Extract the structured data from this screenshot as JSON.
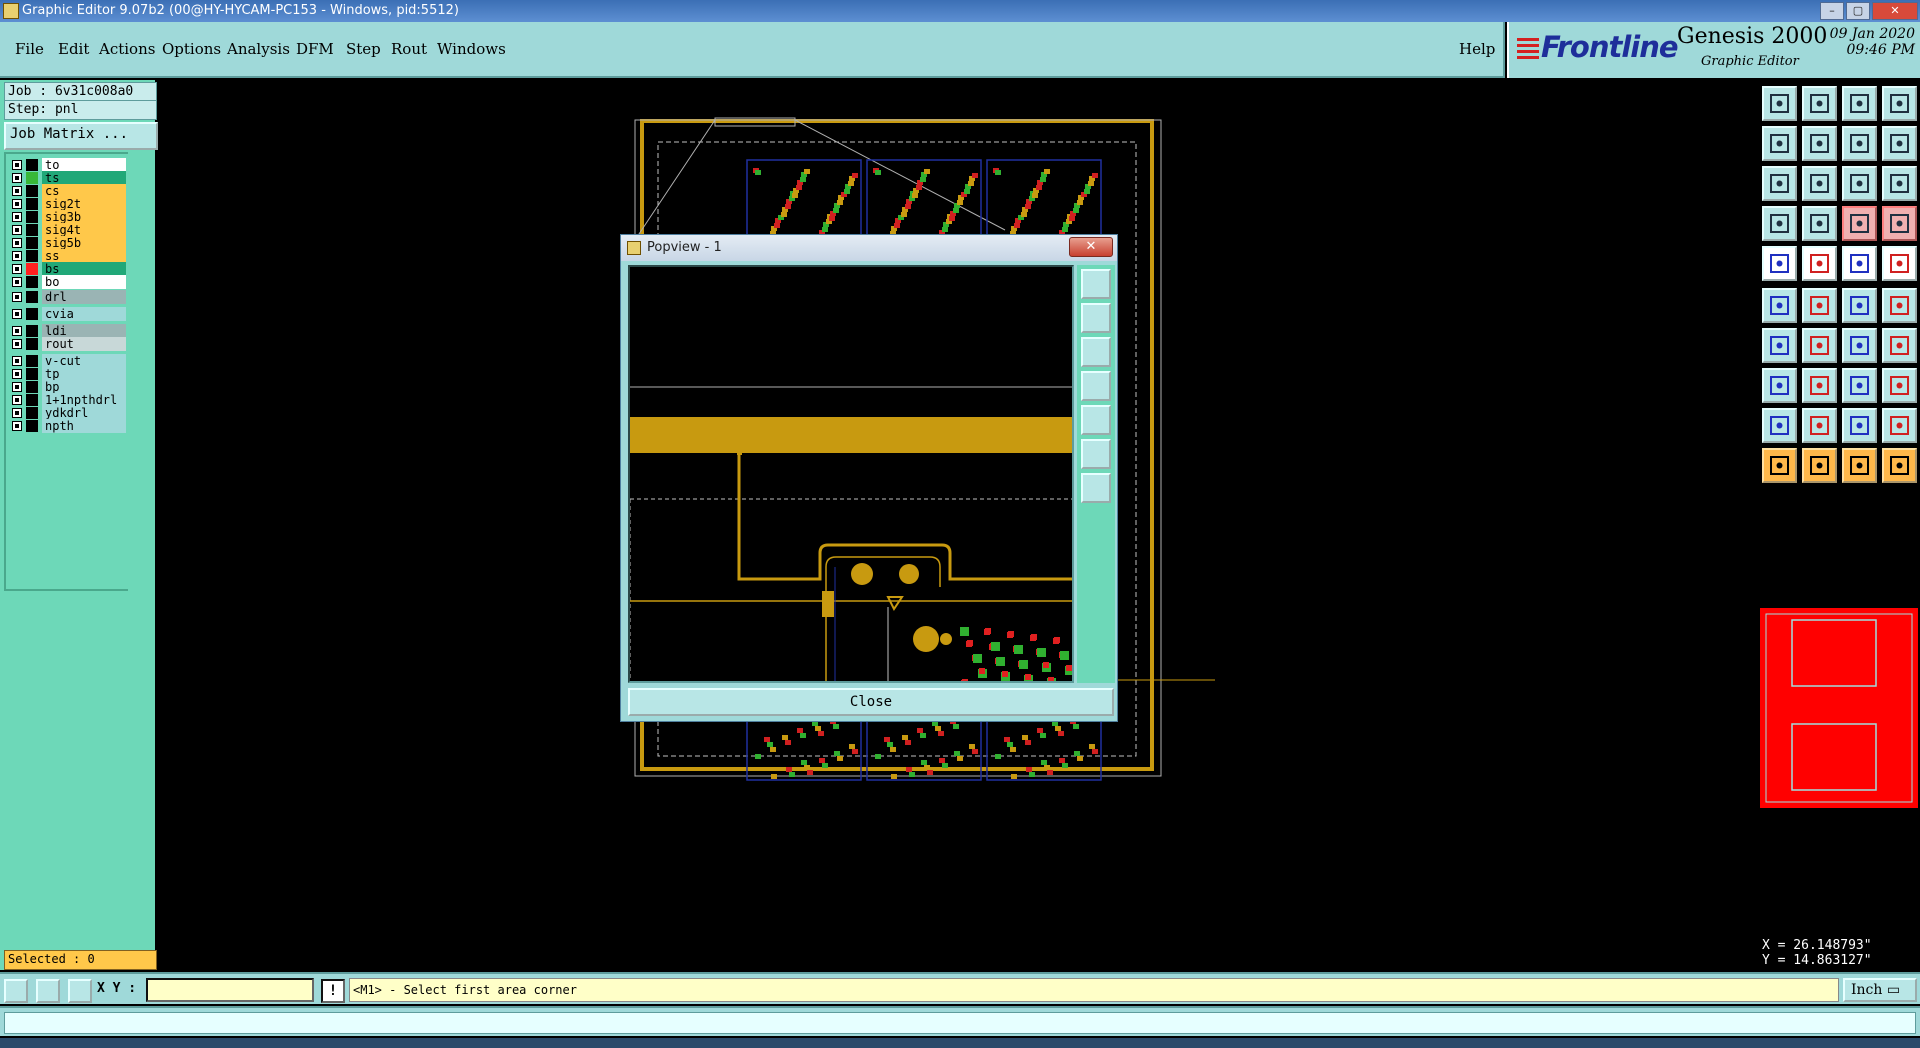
{
  "window": {
    "title": "Graphic Editor 9.07b2 (00@HY-HYCAM-PC153 - Windows, pid:5512)"
  },
  "menubar": {
    "items": [
      "File",
      "Edit",
      "Actions",
      "Options",
      "Analysis",
      "DFM",
      "Step",
      "Rout",
      "Windows"
    ],
    "help": "Help"
  },
  "brand": {
    "logo": "Frontline",
    "product": "Genesis 2000",
    "subtitle": "Graphic Editor",
    "date": "09 Jan 2020",
    "time": "09:46 PM"
  },
  "job": {
    "job_label": "Job : 6v31c008a0",
    "step_label": "Step: pnl",
    "matrix_button": "Job Matrix ..."
  },
  "layers": [
    {
      "name": "to",
      "bg": "#ffffff",
      "swatch": "#000000"
    },
    {
      "name": "ts",
      "bg": "#21a878",
      "swatch": "#38b838"
    },
    {
      "name": "cs",
      "bg": "#ffc84a",
      "swatch": "#000000"
    },
    {
      "name": "sig2t",
      "bg": "#ffc84a",
      "swatch": "#000000"
    },
    {
      "name": "sig3b",
      "bg": "#ffc84a",
      "swatch": "#000000"
    },
    {
      "name": "sig4t",
      "bg": "#ffc84a",
      "swatch": "#000000"
    },
    {
      "name": "sig5b",
      "bg": "#ffc84a",
      "swatch": "#000000"
    },
    {
      "name": "ss",
      "bg": "#ffc84a",
      "swatch": "#000000"
    },
    {
      "name": "bs",
      "bg": "#21a878",
      "swatch": "#ff2020"
    },
    {
      "name": "bo",
      "bg": "#ffffff",
      "swatch": "#000000"
    },
    {
      "name": "drl",
      "bg": "#9ab4b4",
      "swatch": "#000000"
    },
    {
      "name": "cvia",
      "bg": "#9fd9d9",
      "swatch": "#000000"
    },
    {
      "name": "ldi",
      "bg": "#9ab4b4",
      "swatch": "#000000"
    },
    {
      "name": "rout",
      "bg": "#c8d8d8",
      "swatch": "#000000"
    },
    {
      "name": "v-cut",
      "bg": "#9fd9d9",
      "swatch": "#000000"
    },
    {
      "name": "tp",
      "bg": "#9fd9d9",
      "swatch": "#000000"
    },
    {
      "name": "bp",
      "bg": "#9fd9d9",
      "swatch": "#000000"
    },
    {
      "name": "1+1npthdrl",
      "bg": "#9fd9d9",
      "swatch": "#000000"
    },
    {
      "name": "ydkdrl",
      "bg": "#9fd9d9",
      "swatch": "#000000"
    },
    {
      "name": "npth",
      "bg": "#9fd9d9",
      "swatch": "#000000"
    }
  ],
  "selected": "Selected : 0",
  "popview": {
    "title": "Popview - 1",
    "close_label": "Close"
  },
  "coords": {
    "x": "X = 26.148793\"",
    "y": "Y = 14.863127\""
  },
  "bottom": {
    "xy_label": "X Y :",
    "xy_value": "",
    "message": "<M1> - Select first area corner",
    "units": "Inch"
  },
  "colors": {
    "panel": "#9fd9d9",
    "copper": "#c89a10",
    "accent_red": "#ff0000"
  }
}
